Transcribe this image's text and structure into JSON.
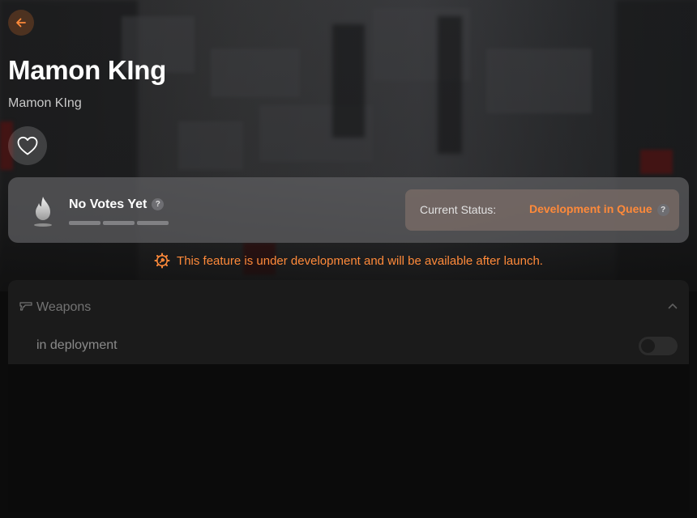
{
  "header": {
    "title": "Mamon KIng",
    "subtitle": "Mamon KIng"
  },
  "votes": {
    "label": "No Votes Yet",
    "help_glyph": "?",
    "progress_segments": 3,
    "progress_filled": 0
  },
  "status": {
    "label": "Current Status:",
    "value": "Development in Queue",
    "help_glyph": "?"
  },
  "notice": {
    "text": "This feature is under development and will be available after launch."
  },
  "weapons": {
    "title": "Weapons",
    "expanded": true,
    "items": [
      {
        "label": "in deployment",
        "enabled": false
      }
    ]
  },
  "colors": {
    "accent": "#ff8a3a",
    "panel": "#0b0b0b",
    "card": "#5f5f62"
  },
  "icons": {
    "back": "arrow-left-icon",
    "favorite": "heart-outline-icon",
    "votes": "flame-icon",
    "notice": "gear-wrench-icon",
    "weapons": "gun-icon",
    "collapse": "chevron-up-icon"
  }
}
